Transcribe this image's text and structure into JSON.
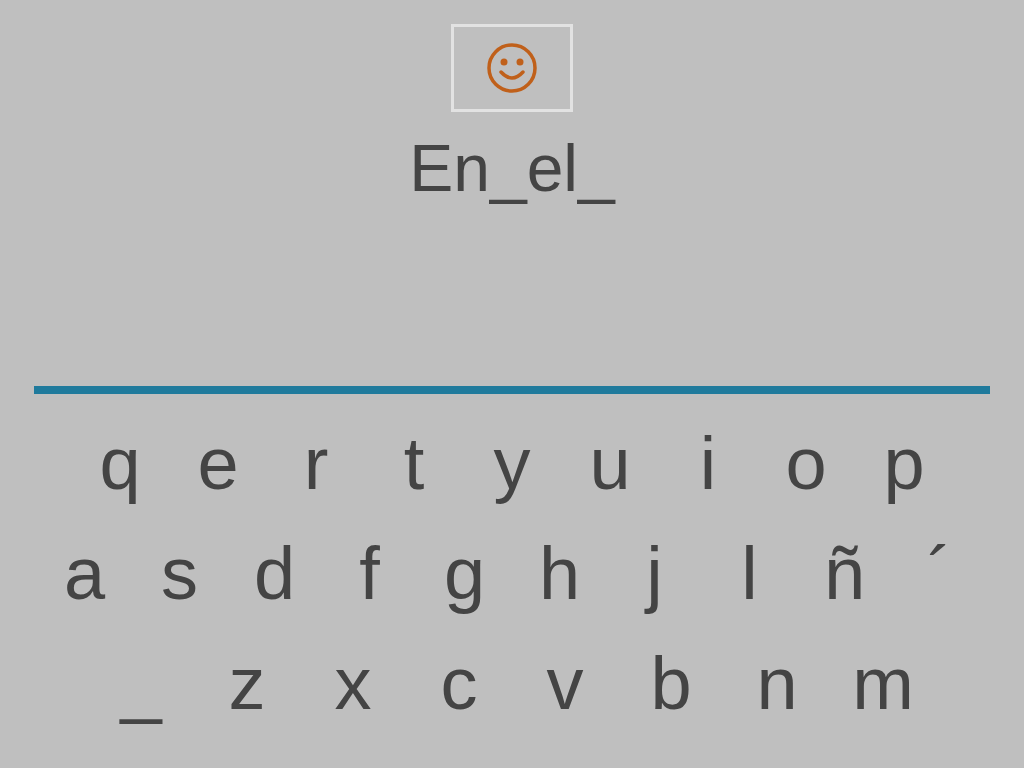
{
  "typed_text": "En_el_",
  "keyboard": {
    "rows": [
      [
        "q",
        "e",
        "r",
        "t",
        "y",
        "u",
        "i",
        "o",
        "p"
      ],
      [
        "a",
        "s",
        "d",
        "f",
        "g",
        "h",
        "j",
        "l",
        "ñ",
        "´"
      ],
      [
        "_",
        "z",
        "x",
        "c",
        "v",
        "b",
        "n",
        "m"
      ]
    ]
  }
}
